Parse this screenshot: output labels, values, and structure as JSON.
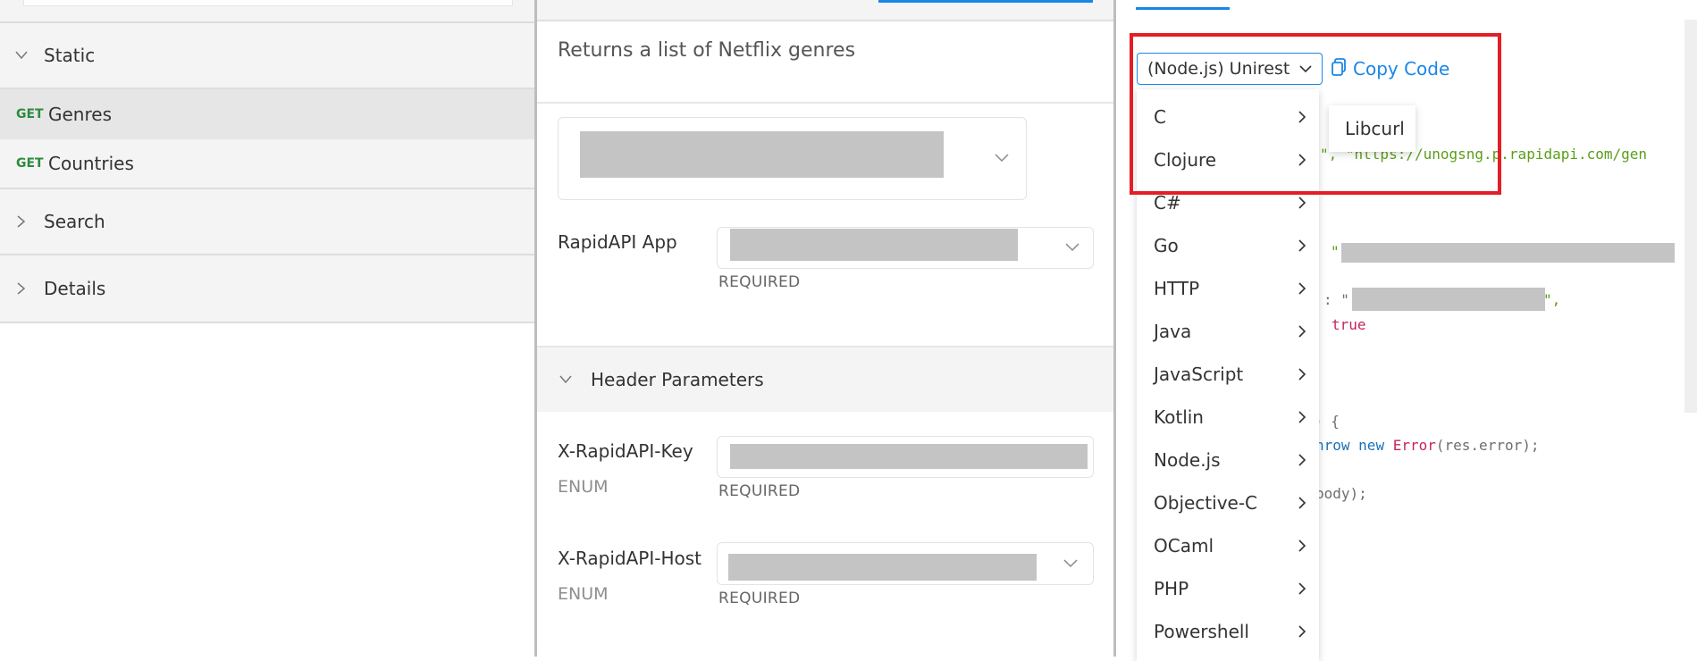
{
  "sidebar": {
    "groups": [
      {
        "label": "Static"
      },
      {
        "label": "Search"
      },
      {
        "label": "Details"
      }
    ],
    "endpoints": [
      {
        "verb": "GET",
        "name": "Genres"
      },
      {
        "verb": "GET",
        "name": "Countries"
      }
    ]
  },
  "middle": {
    "description": "Returns a list of Netflix genres",
    "rapidapi_app_label": "RapidAPI App",
    "required_label": "REQUIRED",
    "header_section_label": "Header Parameters",
    "params": [
      {
        "name": "X-RapidAPI-Key",
        "type": "ENUM",
        "required": "REQUIRED"
      },
      {
        "name": "X-RapidAPI-Host",
        "type": "ENUM",
        "required": "REQUIRED"
      }
    ]
  },
  "code_panel": {
    "selected_language": "(Node.js) Unirest",
    "copy_label": "Copy Code",
    "menu_items": [
      "C",
      "Clojure",
      "C#",
      "Go",
      "HTTP",
      "Java",
      "JavaScript",
      "Kotlin",
      "Node.js",
      "Objective-C",
      "OCaml",
      "PHP",
      "Powershell"
    ],
    "submenu_item": "Libcurl",
    "code_fragments": {
      "url_line": "\", \"https://unogsng.p.rapidapi.com/gen",
      "quote1": "\"",
      "colon_quote": ": \"",
      "quote_comma": "\",",
      "true_word": "true",
      "brace_line": ") {",
      "throw_pre": "hrow ",
      "new_kw": "new",
      "error_kw": "Error",
      "throw_post": "(res.error);",
      "body_line": "body);"
    }
  },
  "colors": {
    "accent": "#1a86e8",
    "get_verb": "#2e8b3e",
    "highlight_box": "#e31e26"
  }
}
